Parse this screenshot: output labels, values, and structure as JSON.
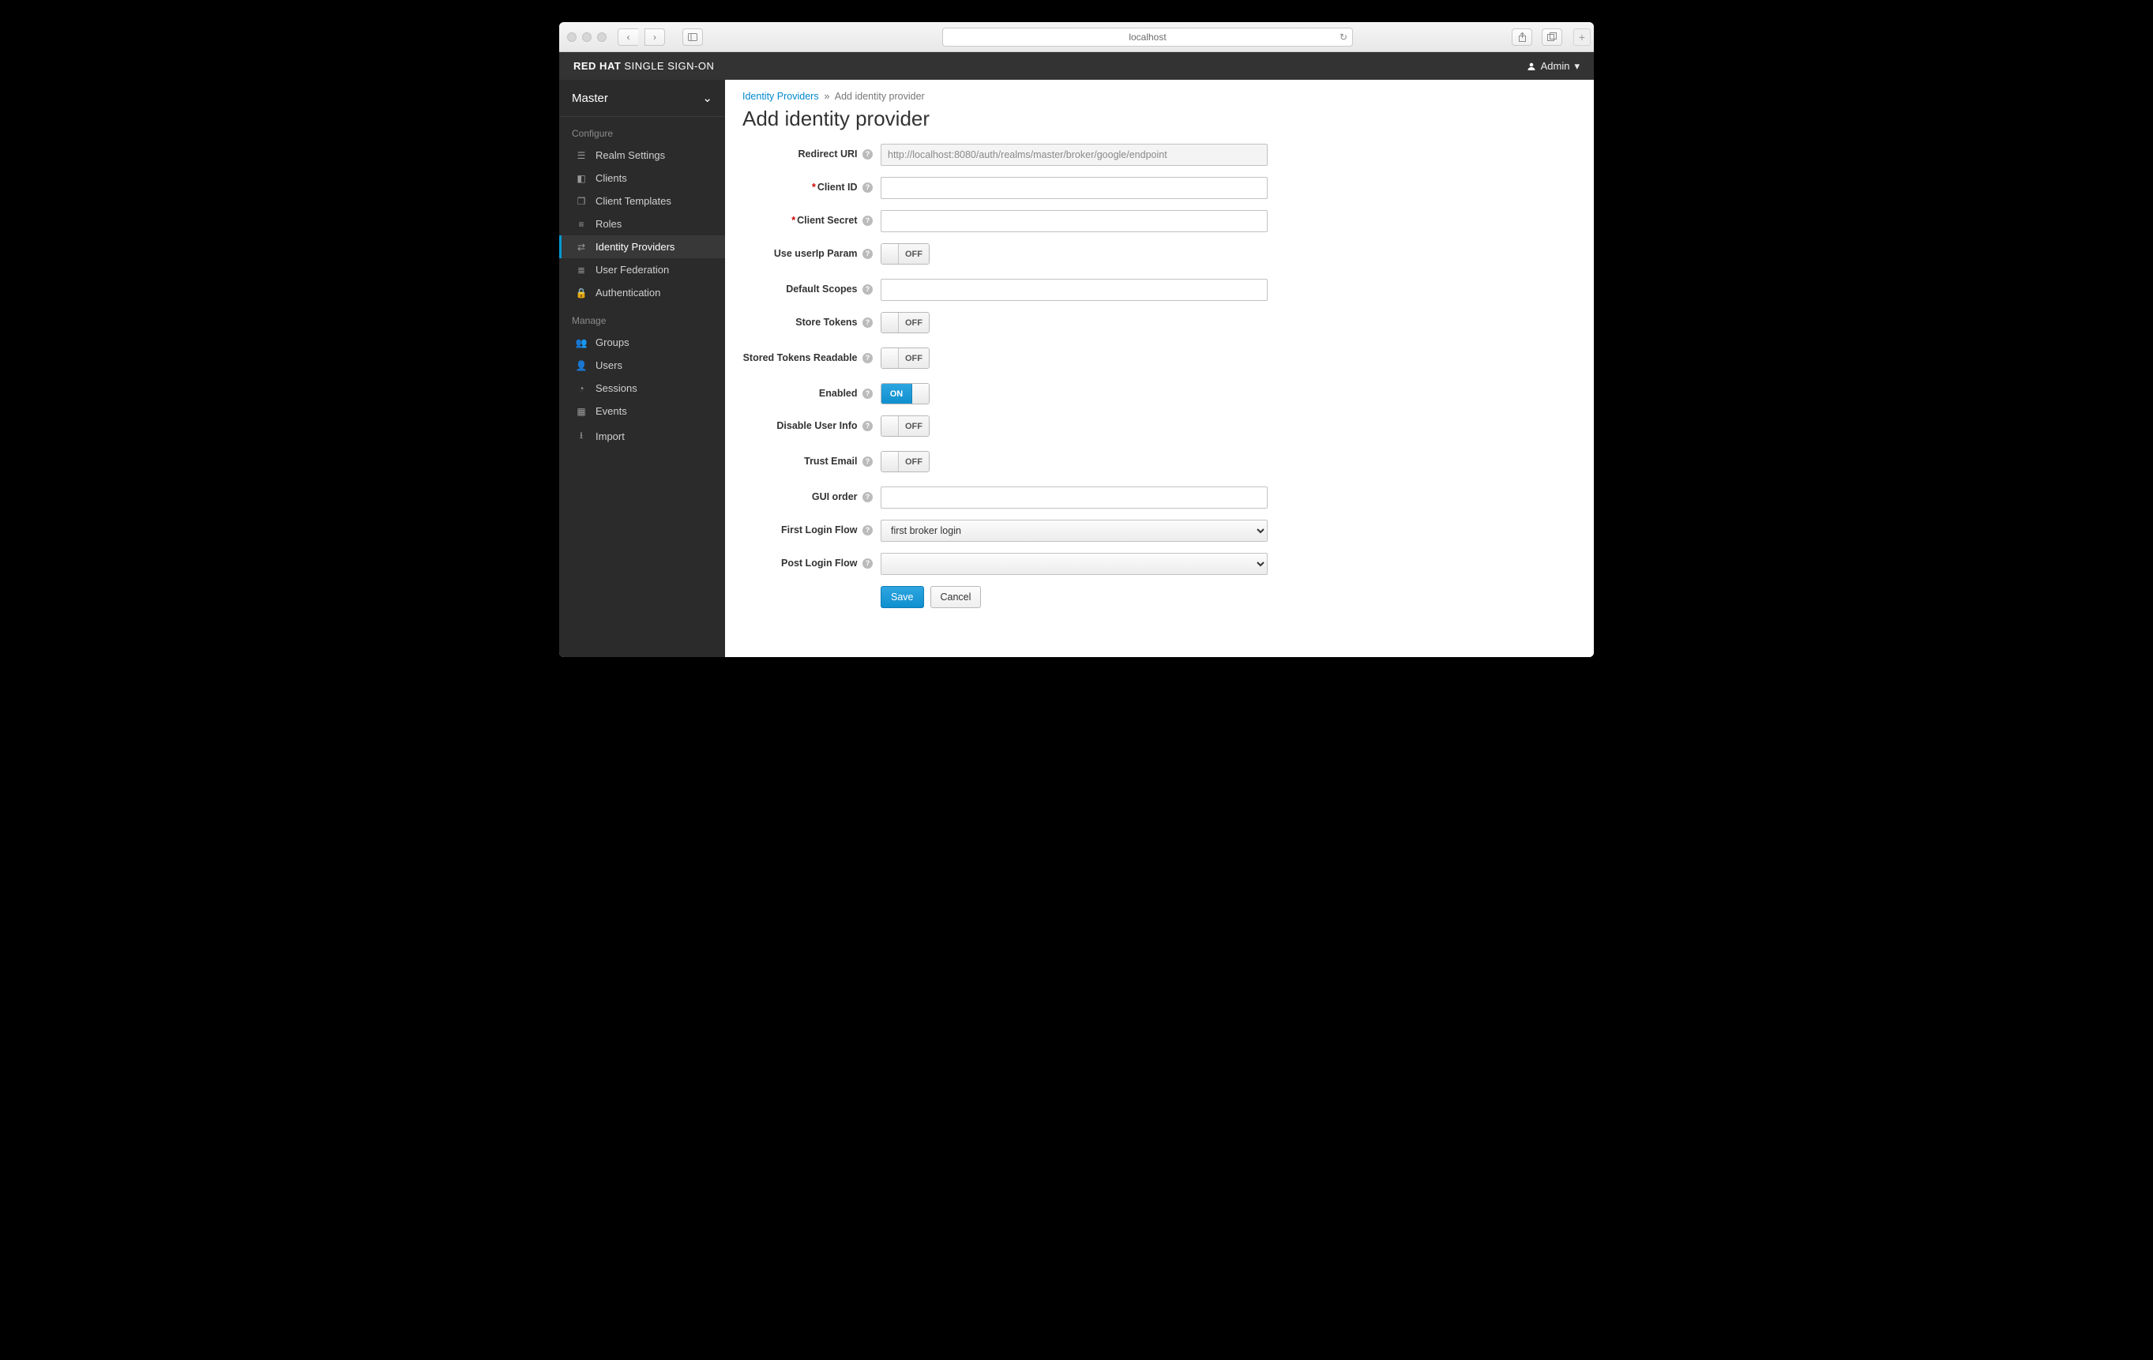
{
  "browser": {
    "address": "localhost"
  },
  "brand": {
    "bold": "RED HAT",
    "rest": " SINGLE SIGN-ON"
  },
  "user_menu": "Admin",
  "realm": "Master",
  "sidebar": {
    "sections": {
      "configure": "Configure",
      "manage": "Manage"
    },
    "configure": [
      {
        "label": "Realm Settings"
      },
      {
        "label": "Clients"
      },
      {
        "label": "Client Templates"
      },
      {
        "label": "Roles"
      },
      {
        "label": "Identity Providers"
      },
      {
        "label": "User Federation"
      },
      {
        "label": "Authentication"
      }
    ],
    "manage": [
      {
        "label": "Groups"
      },
      {
        "label": "Users"
      },
      {
        "label": "Sessions"
      },
      {
        "label": "Events"
      },
      {
        "label": "Import"
      }
    ]
  },
  "breadcrumb": {
    "root": "Identity Providers",
    "sep": "»",
    "current": "Add identity provider"
  },
  "page_title": "Add identity provider",
  "form": {
    "redirect_uri": {
      "label": "Redirect URI",
      "value": "http://localhost:8080/auth/realms/master/broker/google/endpoint"
    },
    "client_id": {
      "label": "Client ID",
      "value": ""
    },
    "client_secret": {
      "label": "Client Secret",
      "value": ""
    },
    "use_userip": {
      "label": "Use userIp Param",
      "state": "OFF"
    },
    "default_scopes": {
      "label": "Default Scopes",
      "value": ""
    },
    "store_tokens": {
      "label": "Store Tokens",
      "state": "OFF"
    },
    "stored_tokens_readable": {
      "label": "Stored Tokens Readable",
      "state": "OFF"
    },
    "enabled": {
      "label": "Enabled",
      "state": "ON"
    },
    "disable_user_info": {
      "label": "Disable User Info",
      "state": "OFF"
    },
    "trust_email": {
      "label": "Trust Email",
      "state": "OFF"
    },
    "gui_order": {
      "label": "GUI order",
      "value": ""
    },
    "first_login_flow": {
      "label": "First Login Flow",
      "value": "first broker login"
    },
    "post_login_flow": {
      "label": "Post Login Flow",
      "value": ""
    }
  },
  "buttons": {
    "save": "Save",
    "cancel": "Cancel"
  }
}
